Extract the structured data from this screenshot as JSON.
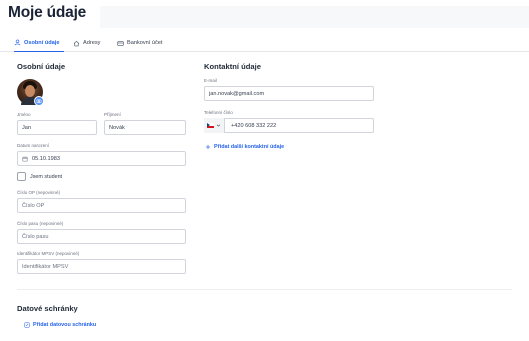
{
  "page": {
    "title": "Moje údaje"
  },
  "tabs": [
    {
      "label": "Osobní údaje",
      "icon": "user-icon",
      "active": true
    },
    {
      "label": "Adresy",
      "icon": "home-icon",
      "active": false
    },
    {
      "label": "Bankovní účet",
      "icon": "card-icon",
      "active": false
    }
  ],
  "personal": {
    "title": "Osobní údaje",
    "first_name": {
      "label": "Jméno",
      "value": "Jan"
    },
    "last_name": {
      "label": "Příjmení",
      "value": "Novák"
    },
    "birth_date": {
      "label": "Datum narození",
      "value": "05.10.1983"
    },
    "student": {
      "label": "Jsem student",
      "checked": false
    },
    "id_card": {
      "label": "Číslo OP (nepovinné)",
      "placeholder": "Číslo OP"
    },
    "passport": {
      "label": "Číslo pasu (nepovinné)",
      "placeholder": "Číslo pasu"
    },
    "mpsv": {
      "label": "Identifikátor MPSV (nepovinné)",
      "placeholder": "Identifikátor MPSV"
    }
  },
  "contact": {
    "title": "Kontaktní údaje",
    "email": {
      "label": "E-mail",
      "value": "jan.novak@gmail.com"
    },
    "phone": {
      "label": "Telefonní číslo",
      "value": "+420 608 332 222",
      "country": "CZ"
    },
    "add_link": "Přidat další kontaktní údaje"
  },
  "data_boxes": {
    "title": "Datové schránky",
    "add_link": "Přidat datovou schránku"
  },
  "colors": {
    "accent": "#2563eb",
    "title": "#1b2437",
    "border": "#d1d5db"
  }
}
